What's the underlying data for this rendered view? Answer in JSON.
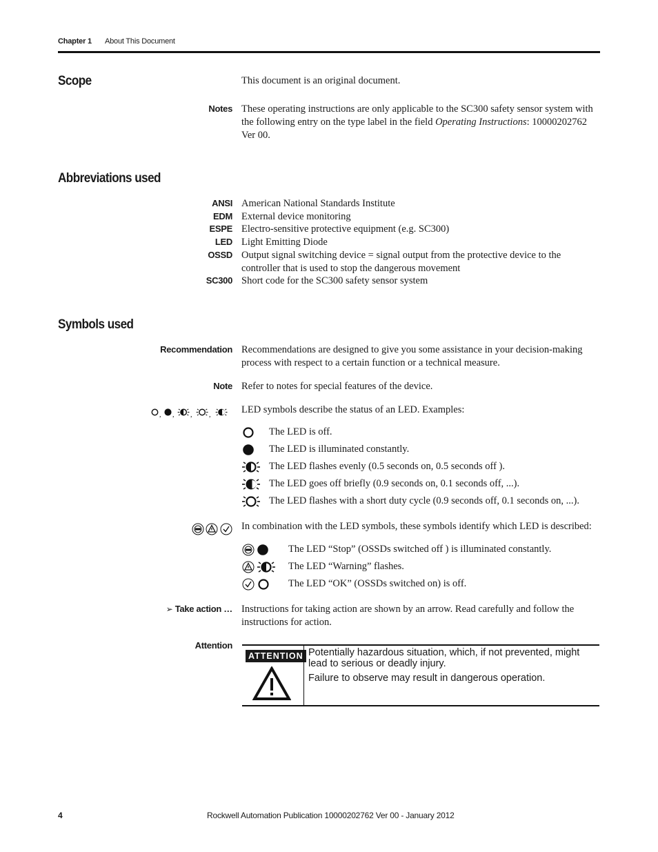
{
  "header": {
    "chapter": "Chapter 1",
    "title": "About This Document"
  },
  "scope": {
    "heading": "Scope",
    "intro": "This document is an original document.",
    "notes_label": "Notes",
    "notes_text_1": "These operating instructions are only applicable to the SC300 safety sensor system with the following entry on the type label in the field ",
    "notes_italic": "Operating Instructions",
    "notes_text_2": ": 10000202762 Ver 00."
  },
  "abbreviations": {
    "heading": "Abbreviations used",
    "items": [
      {
        "key": "ANSI",
        "value": "American National Standards Institute"
      },
      {
        "key": "EDM",
        "value": "External device monitoring"
      },
      {
        "key": "ESPE",
        "value": "Electro-sensitive protective equipment (e.g. SC300)"
      },
      {
        "key": "LED",
        "value": "Light Emitting Diode"
      },
      {
        "key": "OSSD",
        "value": "Output signal switching device = signal output from the protective device to the controller that is used to stop the dangerous movement"
      },
      {
        "key": "SC300",
        "value": "Short code for the SC300 safety sensor system"
      }
    ]
  },
  "symbols": {
    "heading": "Symbols used",
    "recommendation_label": "Recommendation",
    "recommendation_text": "Recommendations are designed to give you some assistance in your decision-making process with respect to a certain function or a technical measure.",
    "note_label": "Note",
    "note_text": "Refer to notes for special features of the device.",
    "led_intro": "LED symbols describe the status of an LED. Examples:",
    "led_items": [
      {
        "icon": "led-off-icon",
        "text": "The LED is off."
      },
      {
        "icon": "led-on-icon",
        "text": "The LED is illuminated constantly."
      },
      {
        "icon": "led-flash-even-icon",
        "text": "The LED flashes evenly (0.5 seconds on, 0.5 seconds off )."
      },
      {
        "icon": "led-off-briefly-icon",
        "text": "The LED goes off briefly (0.9 seconds on, 0.1 seconds off, ...)."
      },
      {
        "icon": "led-short-duty-icon",
        "text": "The LED flashes with a short duty cycle (0.9 seconds off, 0.1 seconds on, ...)."
      }
    ],
    "combo_intro": "In combination with the LED symbols, these symbols identify which LED is described:",
    "combo_items": [
      {
        "icon": "stop-icon",
        "led": "led-on-icon",
        "text": "The LED “Stop” (OSSDs switched off ) is illuminated constantly."
      },
      {
        "icon": "warning-icon",
        "led": "led-flash-even-icon",
        "text": "The LED “Warning” flashes."
      },
      {
        "icon": "ok-check-icon",
        "led": "led-off-icon",
        "text": "The LED “OK” (OSSDs switched on) is off."
      }
    ],
    "stop_glyph_text": "STOP",
    "take_action_arrow": "➢",
    "take_action_label": "Take action …",
    "take_action_text": "Instructions for taking action are shown by an arrow. Read carefully and follow the instructions for action.",
    "attention_label": "Attention",
    "attention_badge": "ATTENTION",
    "attention_text_1": "Potentially hazardous situation, which, if not prevented, might lead to serious or deadly injury.",
    "attention_text_2": "Failure to observe may result in dangerous operation."
  },
  "footer": {
    "page_number": "4",
    "publication": "Rockwell Automation Publication 10000202762 Ver 00 - January 2012"
  }
}
